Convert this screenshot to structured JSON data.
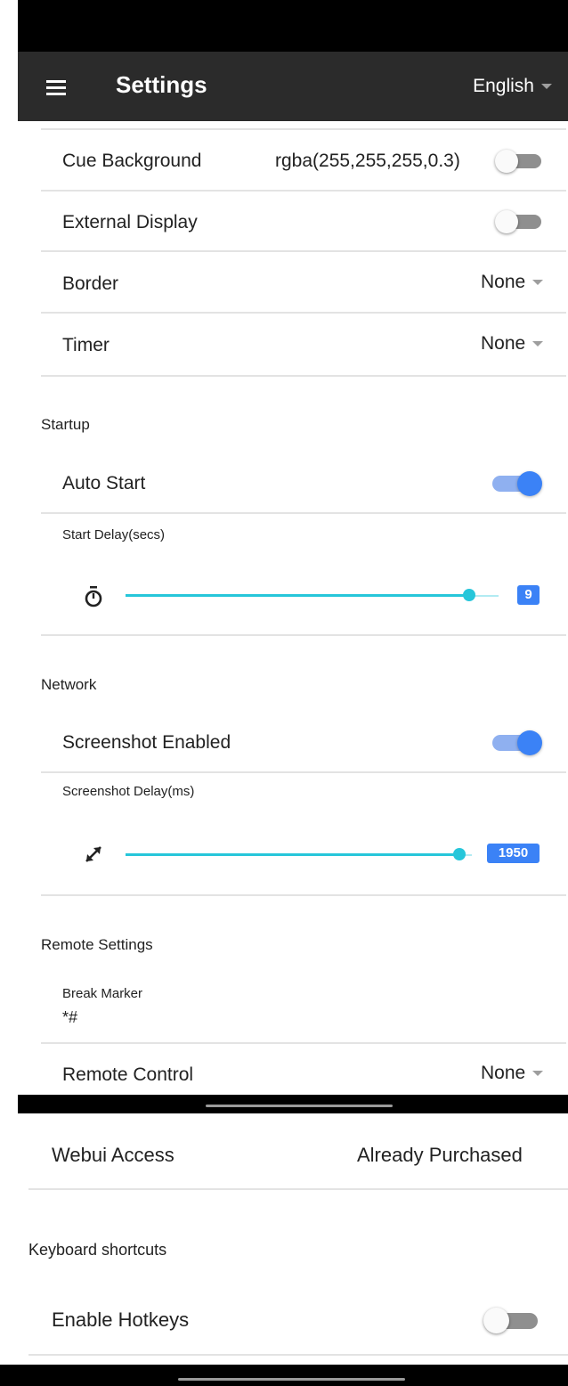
{
  "header": {
    "title": "Settings",
    "language": "English"
  },
  "display": {
    "cue_background": {
      "label": "Cue Background",
      "value": "rgba(255,255,255,0.3)",
      "enabled": false
    },
    "external_display": {
      "label": "External Display",
      "enabled": false
    },
    "border": {
      "label": "Border",
      "value": "None"
    },
    "timer": {
      "label": "Timer",
      "value": "None"
    }
  },
  "startup": {
    "section_title": "Startup",
    "auto_start": {
      "label": "Auto Start",
      "enabled": true
    },
    "start_delay": {
      "label": "Start Delay(secs)",
      "value": "9",
      "fraction": 0.89
    }
  },
  "network": {
    "section_title": "Network",
    "screenshot_enabled": {
      "label": "Screenshot Enabled",
      "enabled": true
    },
    "screenshot_delay": {
      "label": "Screenshot Delay(ms)",
      "value": "1950",
      "fraction": 0.97
    }
  },
  "remote": {
    "section_title": "Remote Settings",
    "break_marker": {
      "label": "Break Marker",
      "value": "*#"
    },
    "remote_control": {
      "label": "Remote Control",
      "value": "None"
    }
  },
  "webui": {
    "label": "Webui Access",
    "value": "Already Purchased"
  },
  "keyboard": {
    "section_title": "Keyboard shortcuts",
    "enable_hotkeys": {
      "label": "Enable Hotkeys",
      "enabled": false
    }
  },
  "colors": {
    "toolbar": "#2b2b2b",
    "accent": "#3b82f6",
    "slider": "#26c6da"
  },
  "icons": {
    "menu": "hamburger-icon",
    "timer": "stopwatch-icon",
    "delay": "resize-arrow-icon"
  }
}
